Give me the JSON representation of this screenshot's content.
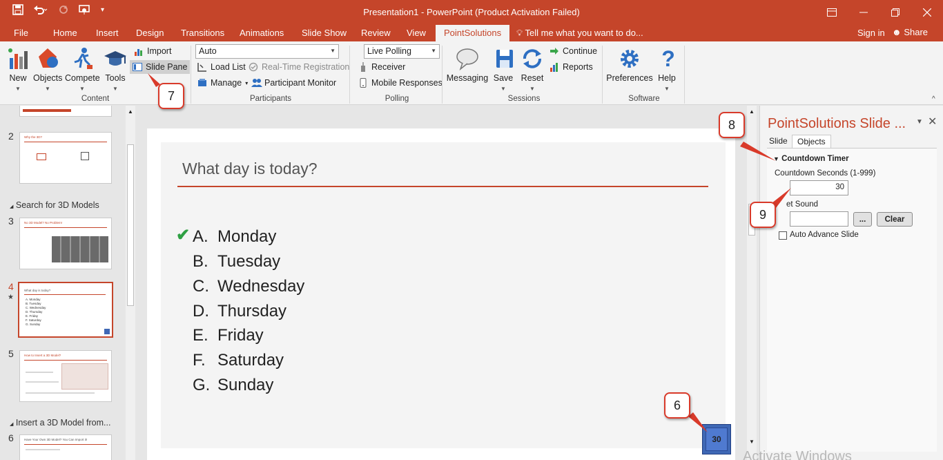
{
  "window": {
    "title": "Presentation1 - PowerPoint (Product Activation Failed)",
    "controls": [
      "restore-ribbon",
      "minimize",
      "maximize",
      "close"
    ]
  },
  "tabs": {
    "items": [
      "File",
      "Home",
      "Insert",
      "Design",
      "Transitions",
      "Animations",
      "Slide Show",
      "Review",
      "View",
      "PointSolutions"
    ],
    "active": "PointSolutions",
    "tell_me": "Tell me what you want to do...",
    "sign_in": "Sign in",
    "share": "Share"
  },
  "ribbon": {
    "content": {
      "new": "New",
      "objects": "Objects",
      "compete": "Compete",
      "tools": "Tools",
      "import": "Import",
      "slide_pane": "Slide Pane",
      "group": "Content"
    },
    "participants": {
      "combo_value": "Auto",
      "load_list": "Load List",
      "realtime": "Real-Time Registration",
      "manage": "Manage",
      "participant_monitor": "Participant Monitor",
      "group": "Participants"
    },
    "polling": {
      "combo_value": "Live Polling",
      "receiver": "Receiver",
      "mobile": "Mobile Responses",
      "group": "Polling"
    },
    "sessions": {
      "messaging": "Messaging",
      "save": "Save",
      "reset": "Reset",
      "continue": "Continue",
      "reports": "Reports",
      "group": "Sessions"
    },
    "software": {
      "preferences": "Preferences",
      "help": "Help",
      "group": "Software"
    }
  },
  "thumbnails": {
    "items": [
      {
        "num": "2",
        "title": "Why the 3D?"
      },
      {
        "num": "3",
        "title": "No 3D Model? No Problem!"
      },
      {
        "num": "4",
        "title": "What day is today?",
        "answers": [
          "A. Monday",
          "B. Tuesday",
          "C. Wednesday",
          "D. Thursday",
          "E. Friday",
          "F. Saturday",
          "G. Sunday"
        ]
      },
      {
        "num": "5",
        "title": "How to Insert a 3D Model?"
      },
      {
        "num": "6",
        "title": "Have Your Own 3D Model? You Can Import it!"
      }
    ],
    "sections": [
      "Search for 3D Models",
      "Insert a 3D Model from..."
    ]
  },
  "slide": {
    "title": "What day is today?",
    "answers": [
      {
        "letter": "A.",
        "text": "Monday"
      },
      {
        "letter": "B.",
        "text": "Tuesday"
      },
      {
        "letter": "C.",
        "text": "Wednesday"
      },
      {
        "letter": "D.",
        "text": "Thursday"
      },
      {
        "letter": "E.",
        "text": "Friday"
      },
      {
        "letter": "F.",
        "text": "Saturday"
      },
      {
        "letter": "G.",
        "text": "Sunday"
      }
    ],
    "correct_answer": "A.",
    "timer": "30"
  },
  "pane": {
    "title": "PointSolutions Slide ...",
    "tabs": [
      "Slide",
      "Objects"
    ],
    "active_tab": "Objects",
    "section": "Countdown Timer",
    "seconds_label": "Countdown Seconds (1-999)",
    "seconds_value": "30",
    "sound_label": "et Sound",
    "browse": "...",
    "clear": "Clear",
    "auto_advance": "Auto Advance Slide"
  },
  "callouts": [
    "6",
    "7",
    "8",
    "9"
  ],
  "watermark": "Activate Windows",
  "colors": {
    "accent": "#c5452a",
    "timer": "#3f68b5",
    "check": "#2ea043"
  }
}
